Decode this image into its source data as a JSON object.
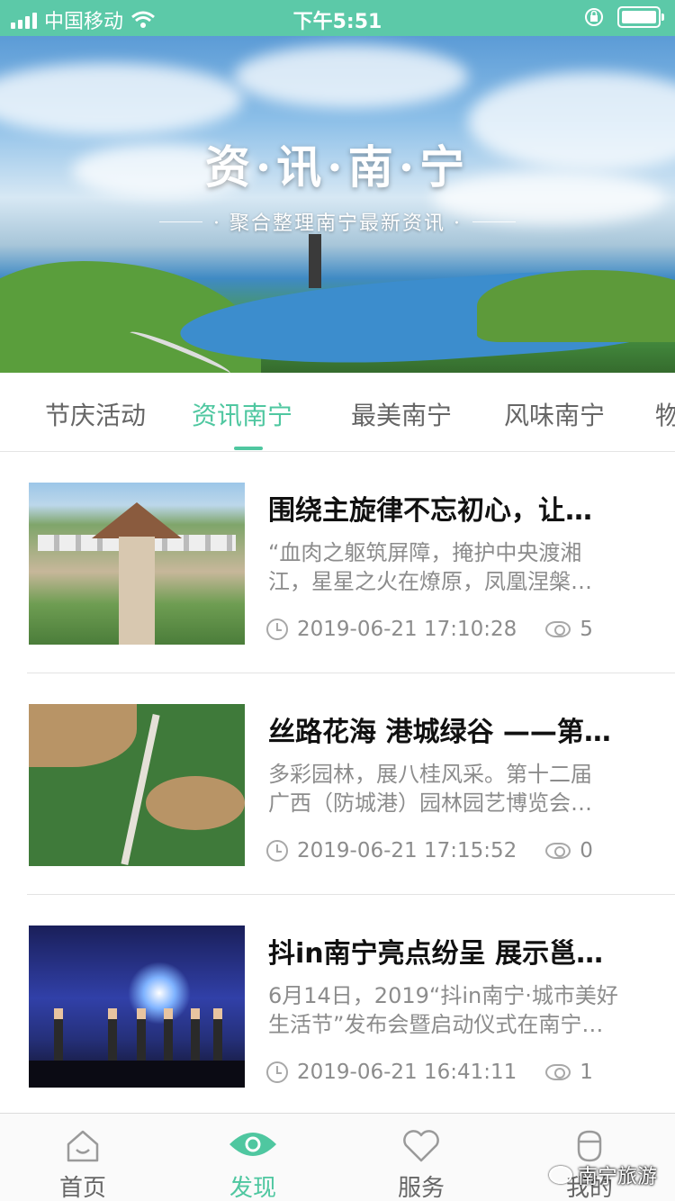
{
  "status_bar": {
    "carrier": "中国移动",
    "time": "下午5:51"
  },
  "banner": {
    "title": "资·讯·南·宁",
    "subtitle": "· 聚合整理南宁最新资讯 ·"
  },
  "tabs": [
    {
      "label": "节庆活动",
      "active": false
    },
    {
      "label": "资讯南宁",
      "active": true
    },
    {
      "label": "最美南宁",
      "active": false
    },
    {
      "label": "风味南宁",
      "active": false
    },
    {
      "label": "物",
      "active": false
    }
  ],
  "articles": [
    {
      "title": "围绕主旋律不忘初心，让…",
      "summary_line1": "“血肉之躯筑屏障，掩护中央渡湘",
      "summary_line2": "江，星星之火在燎原，凤凰涅槃…",
      "date": "2019-06-21 17:10:28",
      "views": "5"
    },
    {
      "title": "丝路花海 港城绿谷 ——第…",
      "summary_line1": "多彩园林，展八桂风采。第十二届",
      "summary_line2": "广西（防城港）园林园艺博览会…",
      "date": "2019-06-21 17:15:52",
      "views": "0"
    },
    {
      "title": "抖in南宁亮点纷呈 展示邕…",
      "summary_line1": "6月14日，2019“抖in南宁·城市美好",
      "summary_line2": "生活节”发布会暨启动仪式在南宁…",
      "date": "2019-06-21 16:41:11",
      "views": "1"
    }
  ],
  "bottom_nav": [
    {
      "label": "首页",
      "icon": "home-icon",
      "active": false
    },
    {
      "label": "发现",
      "icon": "eye-icon",
      "active": true
    },
    {
      "label": "服务",
      "icon": "heart-icon",
      "active": false
    },
    {
      "label": "我的",
      "icon": "user-icon",
      "active": false
    }
  ],
  "watermark": "南宁旅游",
  "colors": {
    "accent": "#4fc7a0",
    "status_bar": "#5cc9a8"
  }
}
